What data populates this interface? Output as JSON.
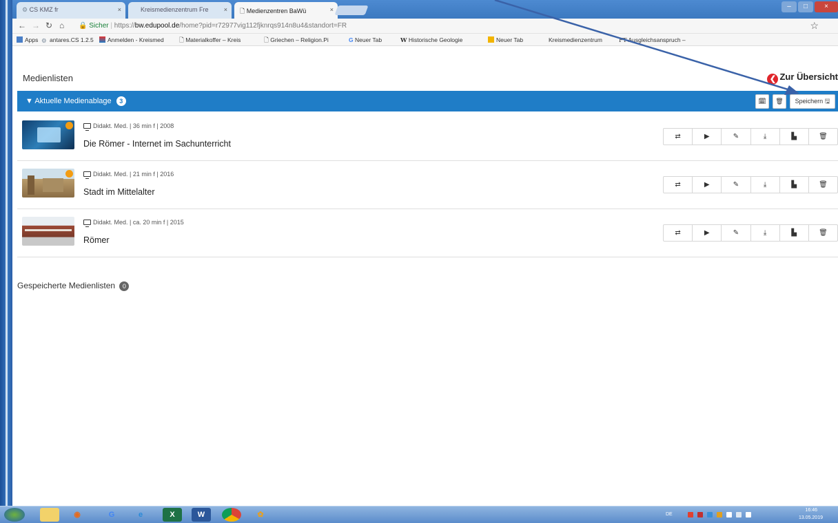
{
  "browser": {
    "tabs": [
      {
        "label": "CS KMZ fr",
        "active": false
      },
      {
        "label": "Kreismedienzentrum Fre",
        "active": false
      },
      {
        "label": "Medienzentren BaWü",
        "active": true
      }
    ],
    "secure_label": "Sicher",
    "url_scheme": "https://",
    "url_host": "bw.edupool.de",
    "url_path": "/home?pid=r72977vig112fjknrqs914n8u4&standort=FR",
    "bookmarks": [
      "Apps",
      "antares.CS 1.2.5",
      "Anmelden - Kreismed",
      "Materialkoffer – Kreis",
      "Griechen – Religion.Pi",
      "Neuer Tab",
      "Historische Geologie",
      "Neuer Tab",
      "Kreismedienzentrum",
      "Ausgleichsanspruch –"
    ]
  },
  "page": {
    "title": "Medienlisten",
    "back_link": "Zur Übersicht",
    "panel": {
      "title": "Aktuelle Medienablage",
      "count": "3",
      "save_label": "Speichern"
    },
    "media": [
      {
        "meta": "Didakt. Med. | 36 min f | 2008",
        "title": "Die Römer - Internet im Sachunterricht",
        "thumb_color": "#2e7fb8"
      },
      {
        "meta": "Didakt. Med. | 21 min f | 2016",
        "title": "Stadt im Mittelalter",
        "thumb_color": "#b89a6a"
      },
      {
        "meta": "Didakt. Med. | ca. 20 min f | 2015",
        "title": "Römer",
        "thumb_color": "#9c4a36"
      }
    ],
    "actions": [
      "⇄",
      "▶",
      "✎",
      "⤓",
      "▙",
      "🗑"
    ],
    "saved_lists_label": "Gespeicherte Medienlisten",
    "saved_lists_count": "0"
  },
  "taskbar": {
    "language": "DE",
    "time": "16:46",
    "date": "13.05.2019"
  },
  "colors": {
    "accent": "#1f7dc7",
    "back_icon": "#e0262c",
    "annotation_arrow": "#3a62a8"
  }
}
